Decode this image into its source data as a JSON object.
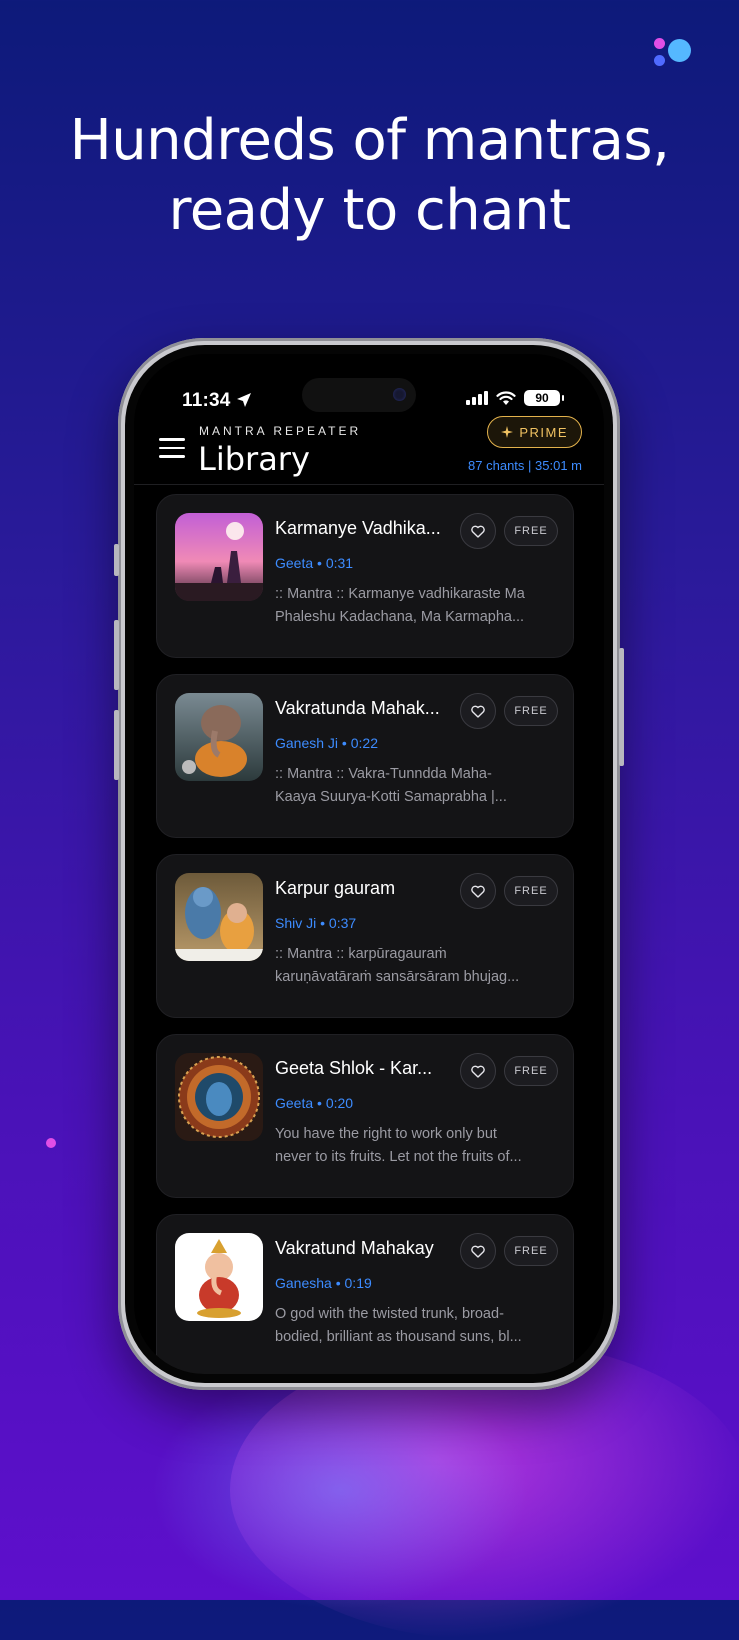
{
  "promo": {
    "headline_line1": "Hundreds of mantras,",
    "headline_line2": "ready to chant"
  },
  "status_bar": {
    "time": "11:34",
    "battery": "90"
  },
  "header": {
    "app_name": "MANTRA REPEATER",
    "title": "Library",
    "prime_label": "PRIME",
    "stats": "87 chants | 35:01 m"
  },
  "mantras": [
    {
      "title": "Karmanye Vadhika...",
      "category": "Geeta",
      "duration": "0:31",
      "desc_line1": ":: Mantra :: Karmanye vadhikaraste Ma",
      "desc_line2": "Phaleshu Kadachana, Ma Karmapha...",
      "badge": "FREE"
    },
    {
      "title": "Vakratunda Mahak...",
      "category": "Ganesh Ji",
      "duration": "0:22",
      "desc_line1": ":: Mantra :: Vakra-Tunndda Maha-",
      "desc_line2": "Kaaya Suurya-Kotti Samaprabha |...",
      "badge": "FREE"
    },
    {
      "title": "Karpur gauram",
      "category": "Shiv Ji",
      "duration": "0:37",
      "desc_line1": ":: Mantra :: karpūragauraṁ",
      "desc_line2": "karuṇāvatāraṁ sansārsāram bhujag...",
      "badge": "FREE"
    },
    {
      "title": "Geeta Shlok - Kar...",
      "category": "Geeta",
      "duration": "0:20",
      "desc_line1": "You have the right to work only but",
      "desc_line2": "never to its fruits. Let not the fruits of...",
      "badge": "FREE"
    },
    {
      "title": "Vakratund Mahakay",
      "category": "Ganesha",
      "duration": "0:19",
      "desc_line1": "O god with the twisted trunk, broad-",
      "desc_line2": "bodied, brilliant as thousand suns, bl...",
      "badge": "FREE"
    }
  ],
  "colors": {
    "accent_blue": "#3d8cff",
    "prime_gold": "#e3b24c",
    "background_top": "#0d1a7a",
    "background_bottom": "#5e0fcc"
  }
}
